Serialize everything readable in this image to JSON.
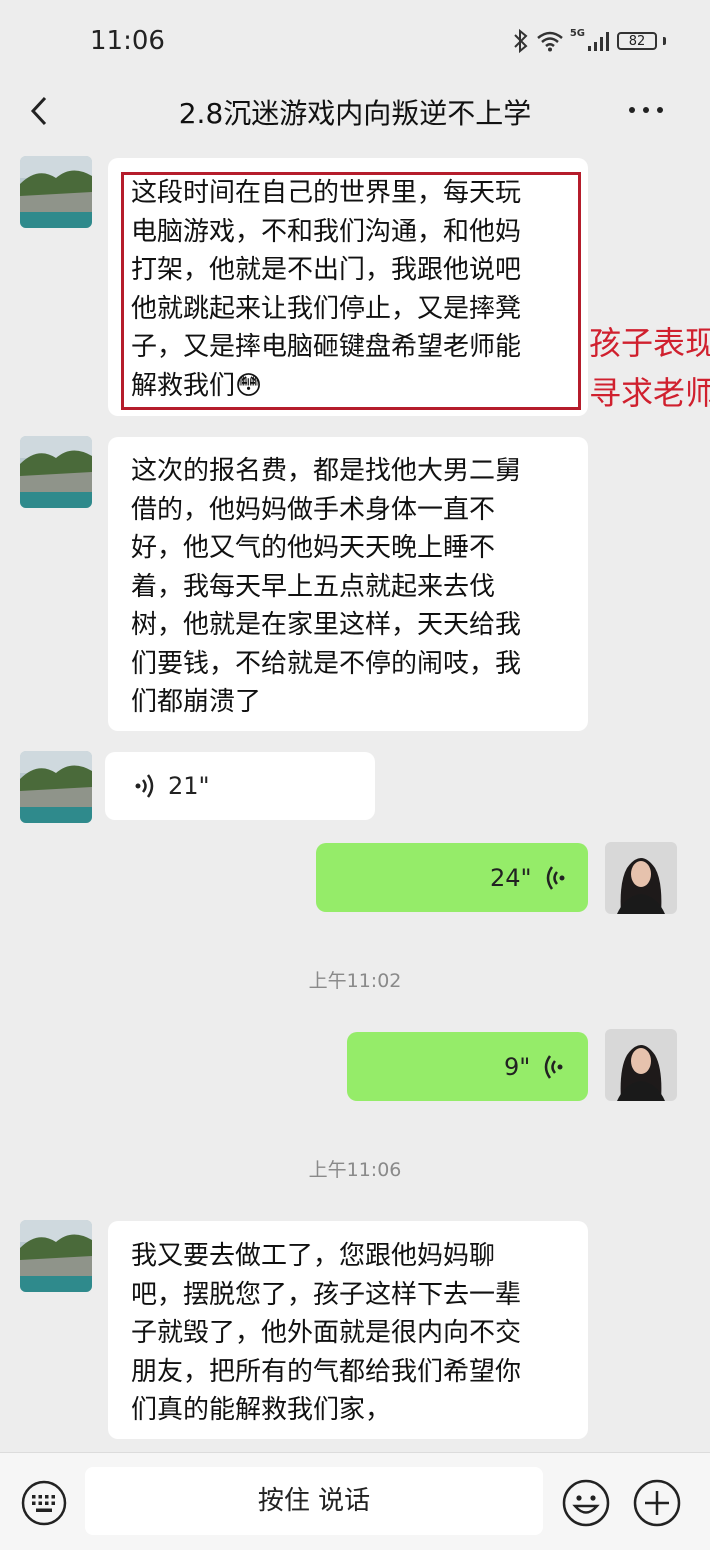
{
  "status_bar": {
    "time": "11:06",
    "battery": "82",
    "network": "5G"
  },
  "header": {
    "title": "2.8沉迷游戏内向叛逆不上学"
  },
  "messages": [
    {
      "side": "in",
      "lines": [
        "这段时间在自己的世界里，每天玩",
        "电脑游戏，不和我们沟通，和他妈",
        "打架，他就是不出门，我跟他说吧",
        "他就跳起来让我们停止，又是摔凳",
        "子，又是摔电脑砸键盘希望老师能",
        "解救我们😳"
      ]
    },
    {
      "side": "in",
      "lines": [
        "这次的报名费，都是找他大男二舅",
        "借的，他妈妈做手术身体一直不",
        "好，他又气的他妈天天晚上睡不",
        "着，我每天早上五点就起来去伐",
        "树，他就是在家里这样，天天给我",
        "们要钱，不给就是不停的闹吱，我",
        "们都崩溃了"
      ]
    },
    {
      "side": "in",
      "voice": "21\""
    },
    {
      "side": "out",
      "voice": "24\""
    },
    {
      "side": "out",
      "voice": "9\""
    },
    {
      "side": "in",
      "lines": [
        "我又要去做工了，您跟他妈妈聊",
        "吧，摆脱您了，孩子这样下去一辈",
        "子就毁了，他外面就是很内向不交",
        "朋友，把所有的气都给我们希望你",
        "们真的能解救我们家，"
      ]
    }
  ],
  "annotation": {
    "line1": "孩子表现",
    "line2": "寻求老师"
  },
  "timestamps": [
    "上午11:02",
    "上午11:06"
  ],
  "input_bar": {
    "hold_to_talk": "按住 说话"
  }
}
